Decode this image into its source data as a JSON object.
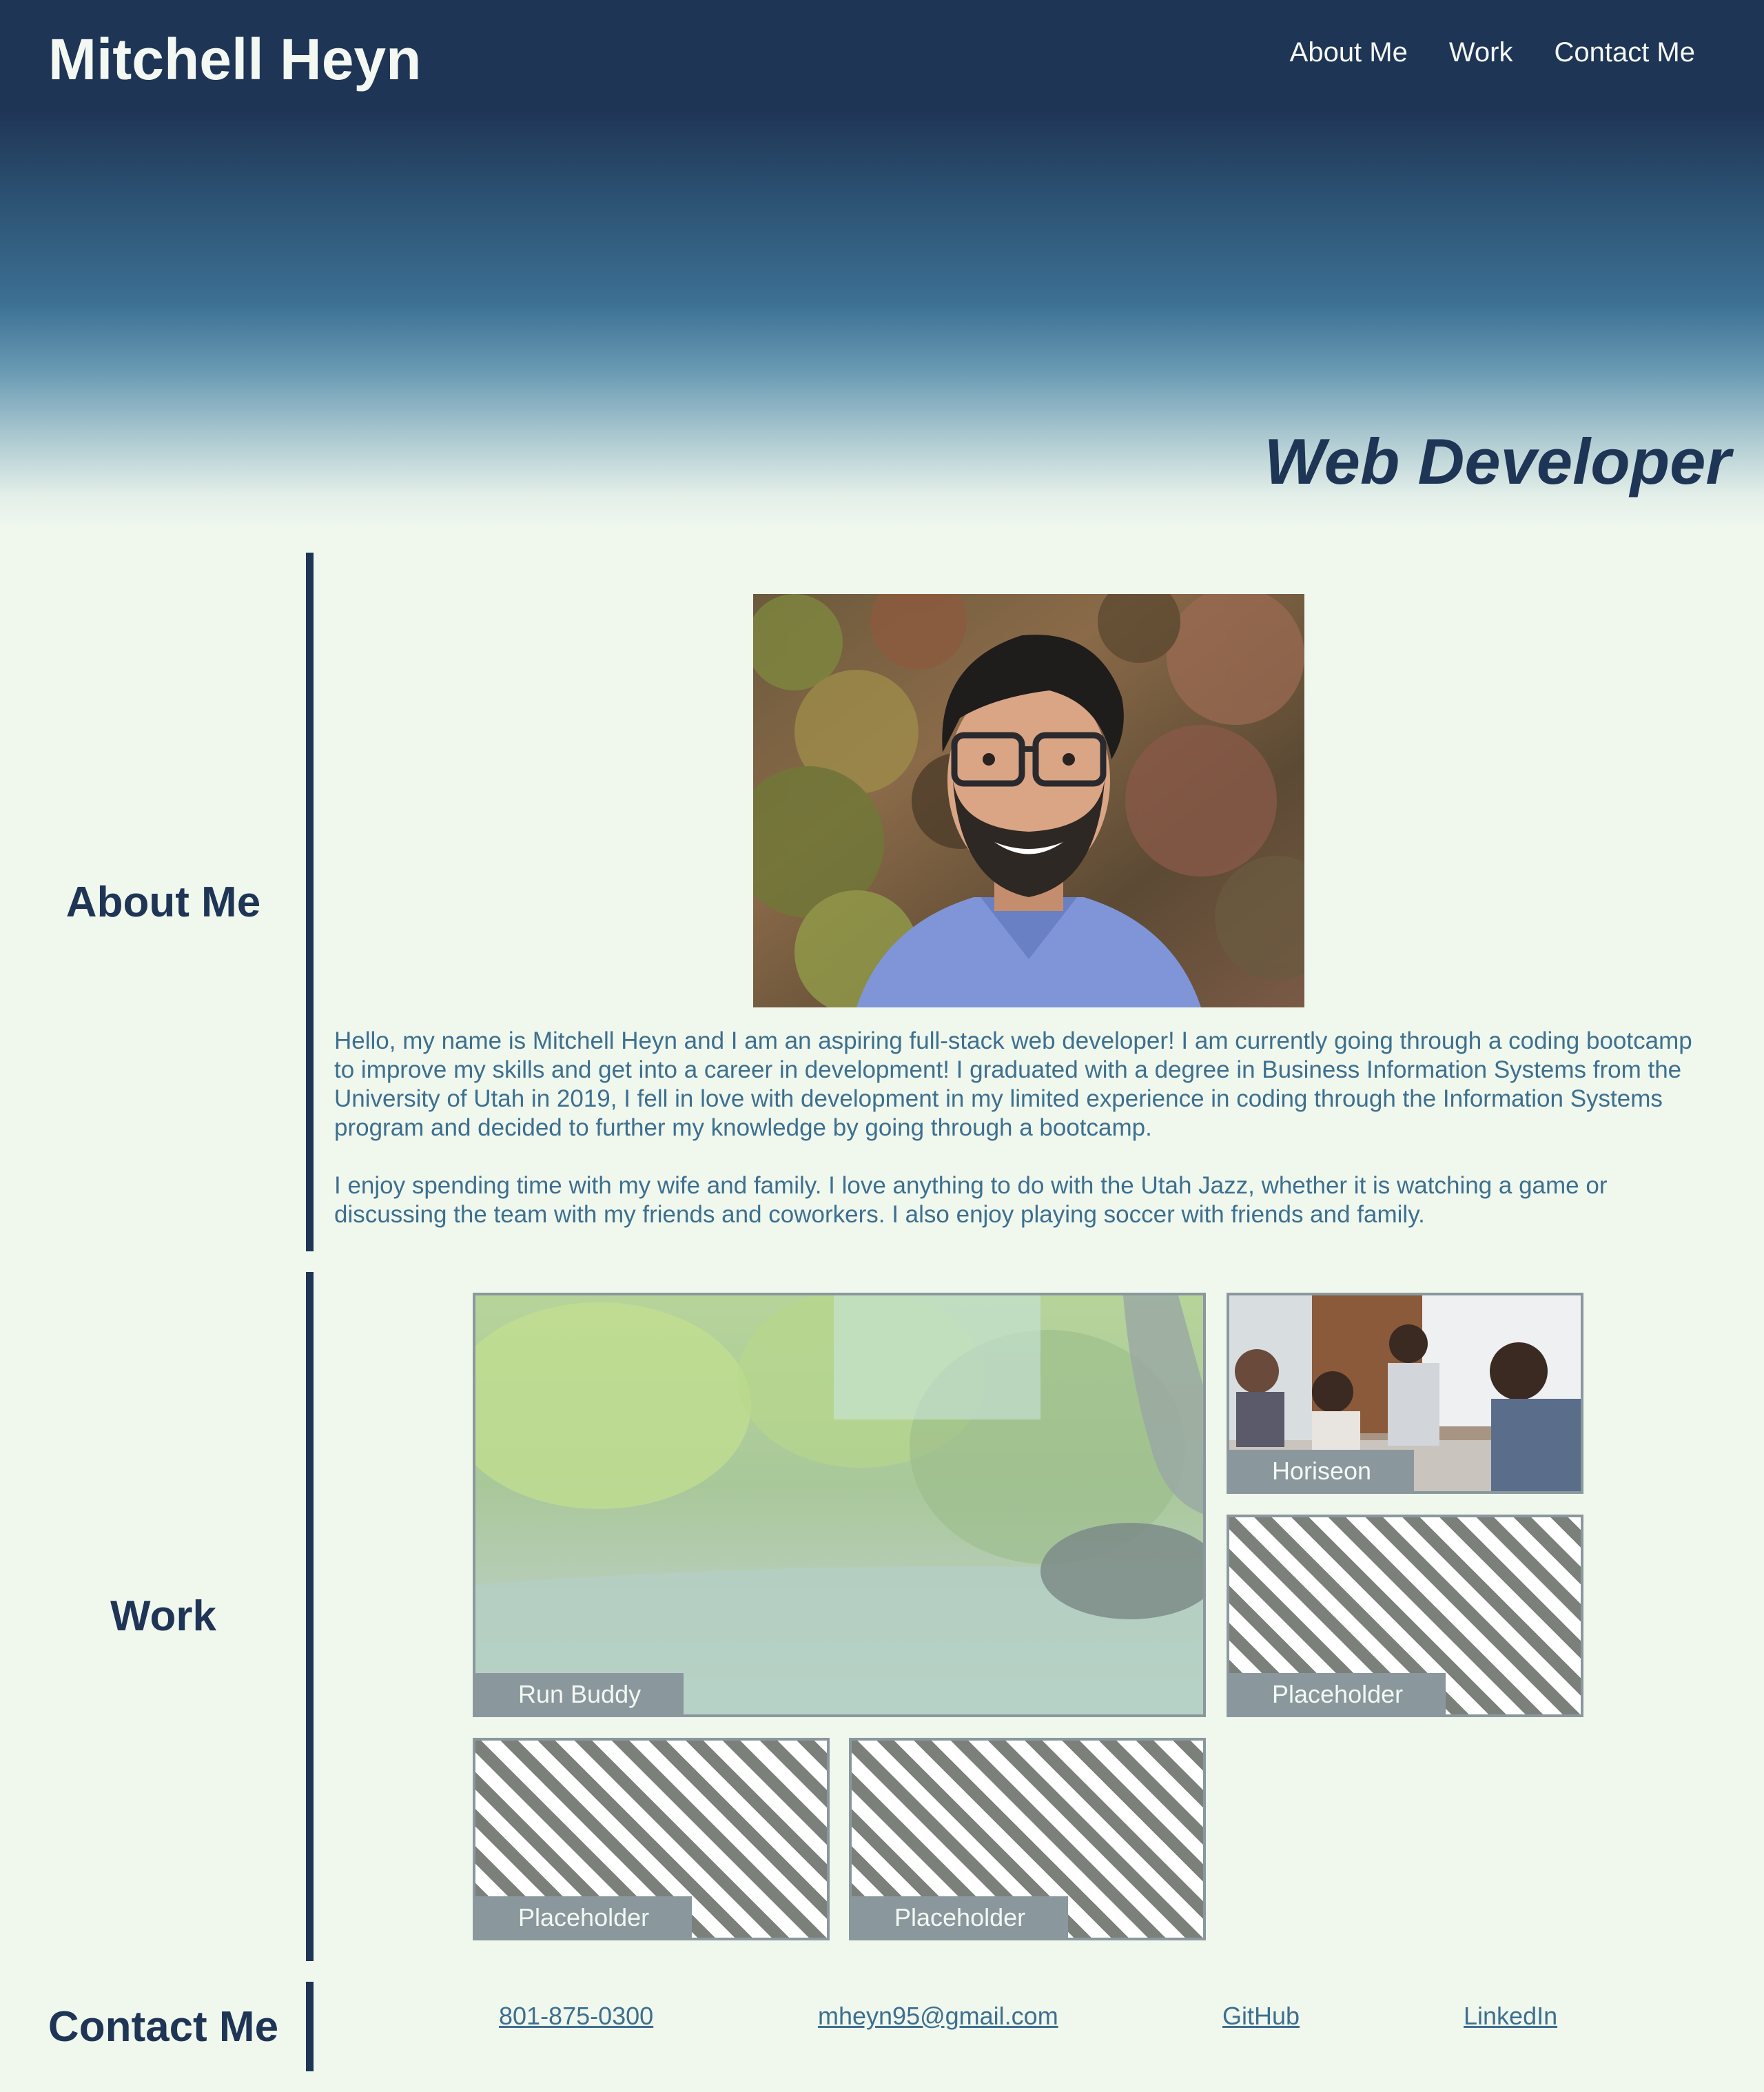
{
  "header": {
    "site_title": "Mitchell Heyn",
    "nav": [
      "About Me",
      "Work",
      "Contact Me"
    ],
    "tagline": "Web Developer"
  },
  "about": {
    "heading": "About Me",
    "paragraphs": [
      "Hello, my name is Mitchell Heyn and I am an aspiring full-stack web developer! I am currently going through a coding bootcamp to improve my skills and get into a career in development! I graduated with a degree in Business Information Systems from the University of Utah in 2019, I fell in love with development in my limited experience in coding through the Information Systems program and decided to further my knowledge by going through a bootcamp.",
      "I enjoy spending time with my wife and family. I love anything to do with the Utah Jazz, whether it is watching a game or discussing the team with my friends and coworkers. I also enjoy playing soccer with friends and family."
    ]
  },
  "work": {
    "heading": "Work",
    "projects": [
      "Run Buddy",
      "Horiseon",
      "Placeholder",
      "Placeholder",
      "Placeholder"
    ]
  },
  "contact": {
    "heading": "Contact Me",
    "phone": "801-875-0300",
    "email": "mheyn95@gmail.com",
    "github": "GitHub",
    "linkedin": "LinkedIn"
  },
  "colors": {
    "navy": "#1f3556",
    "link_blue": "#3d6f8f",
    "page_bg": "#f0f8ee",
    "label_gray": "#8a989e"
  }
}
